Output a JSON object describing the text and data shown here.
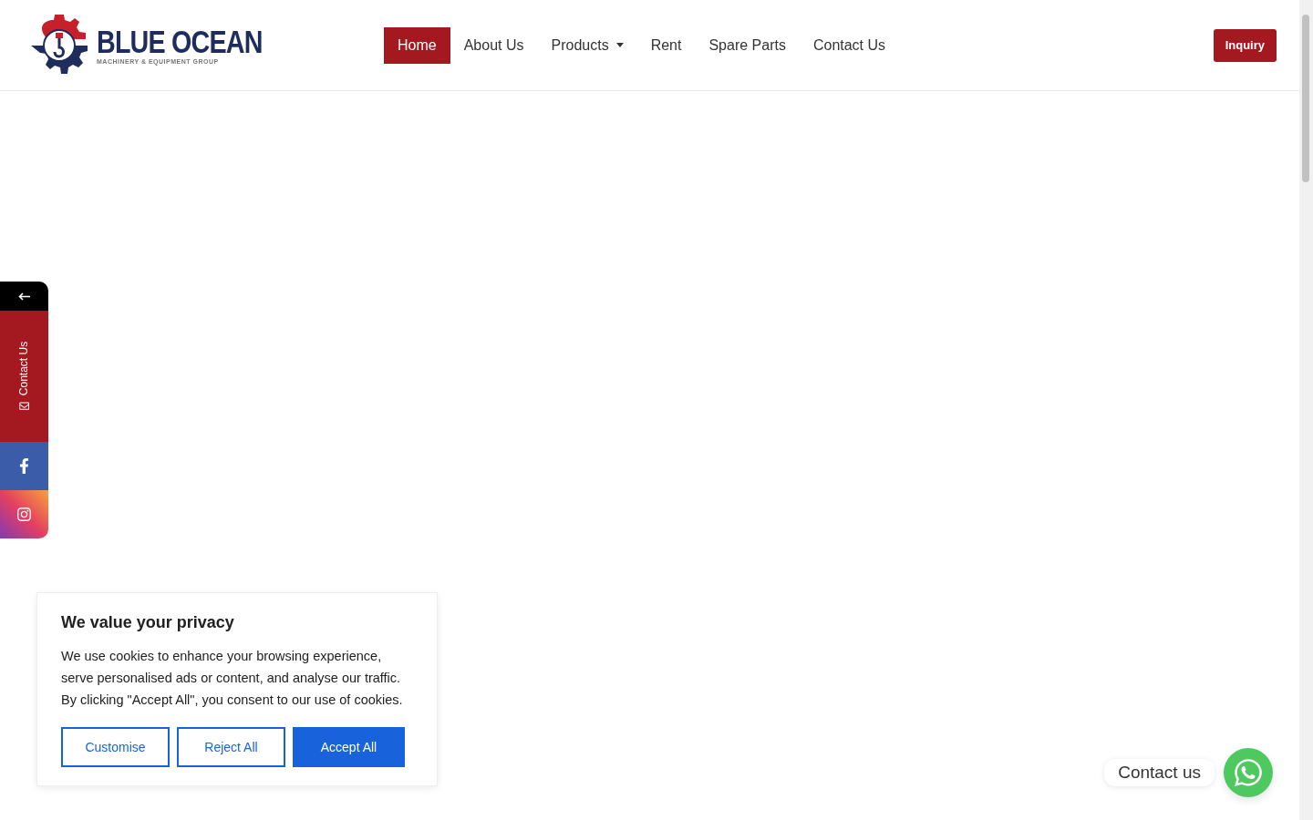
{
  "header": {
    "logo": {
      "name": "BLUE OCEAN",
      "tagline": "MACHINERY & EQUIPMENT GROUP"
    },
    "nav": [
      {
        "label": "Home",
        "selected": true,
        "has_menu": false
      },
      {
        "label": "About Us",
        "selected": false,
        "has_menu": false
      },
      {
        "label": "Products",
        "selected": false,
        "has_menu": true
      },
      {
        "label": "Rent",
        "selected": false,
        "has_menu": false
      },
      {
        "label": "Spare Parts",
        "selected": false,
        "has_menu": false
      },
      {
        "label": "Contact Us",
        "selected": false,
        "has_menu": false
      }
    ],
    "inquiry_button": "Inquiry"
  },
  "side_tab": {
    "label": "Contact Us",
    "links": [
      {
        "kind": "facebook"
      },
      {
        "kind": "instagram"
      }
    ]
  },
  "cookie_banner": {
    "title": "We value your privacy",
    "text": "We use cookies to enhance your browsing experience, serve personalised ads or content, and analyse our traffic. By clicking \"Accept All\", you consent to our use of cookies.",
    "buttons": [
      {
        "label": "Customise",
        "kind": "outline"
      },
      {
        "label": "Reject All",
        "kind": "outline"
      },
      {
        "label": "Accept All",
        "kind": "solid"
      }
    ]
  },
  "chat_widget": {
    "label": "Contact us"
  }
}
